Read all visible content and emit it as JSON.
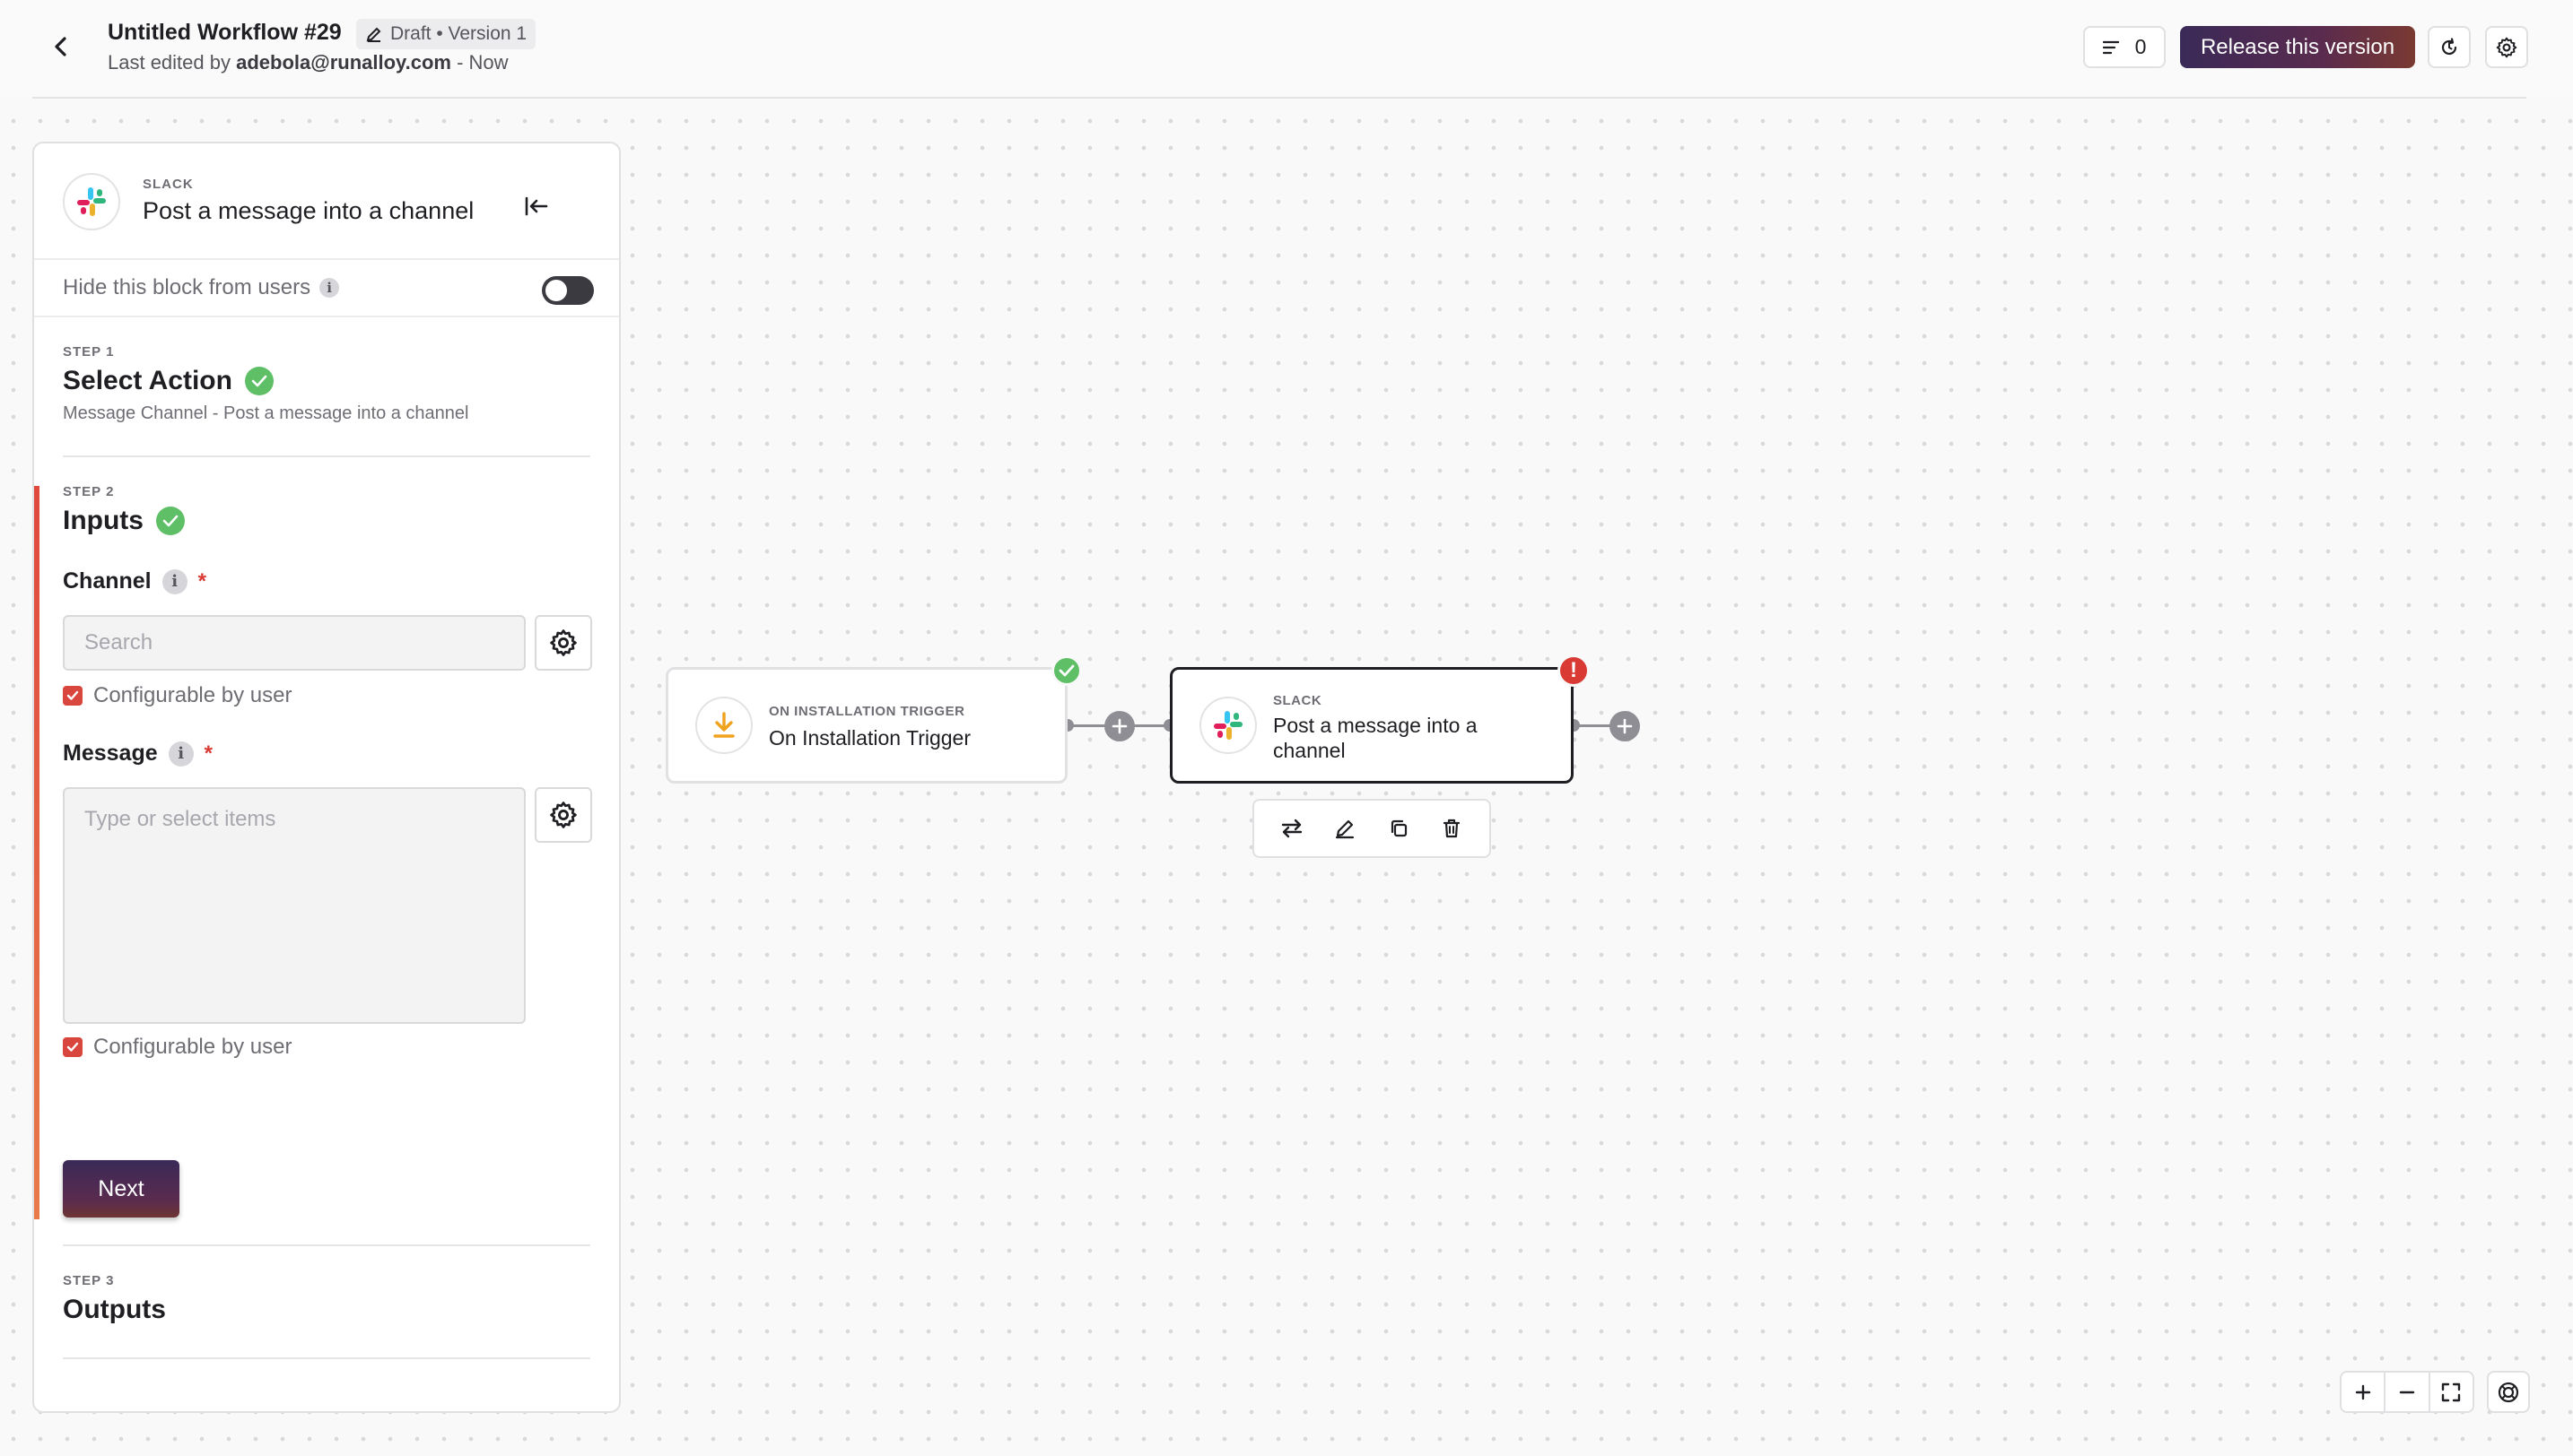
{
  "header": {
    "workflow_title": "Untitled Workflow #29",
    "draft_badge": "Draft • Version 1",
    "last_edited_prefix": "Last edited by",
    "last_edited_user": "adebola@runalloy.com",
    "last_edited_suffix": "- Now",
    "list_count": "0",
    "release_label": "Release this version"
  },
  "panel": {
    "app_name": "SLACK",
    "title": "Post a message into a channel",
    "hide_label": "Hide this block from users",
    "hide_toggle_on": false,
    "step1": {
      "label": "STEP 1",
      "title": "Select Action",
      "subtitle": "Message Channel - Post a message into a channel"
    },
    "step2": {
      "label": "STEP 2",
      "title": "Inputs",
      "channel_label": "Channel",
      "channel_placeholder": "Search",
      "channel_configurable": "Configurable by user",
      "message_label": "Message",
      "message_placeholder": "Type or select items",
      "message_configurable": "Configurable by user",
      "next_label": "Next",
      "required_mark": "*"
    },
    "step3": {
      "label": "STEP 3",
      "title": "Outputs"
    }
  },
  "canvas": {
    "trigger_node": {
      "app": "ON INSTALLATION TRIGGER",
      "name": "On Installation Trigger"
    },
    "slack_node": {
      "app": "SLACK",
      "name_line1": "Post a message into a",
      "name_line2": "channel"
    },
    "error_mark": "!"
  },
  "colors": {
    "accent_dark": "#3a2a58",
    "success": "#5fbf66",
    "error": "#d93a34",
    "checkbox": "#d9463d"
  },
  "icons": {
    "back": "chevron-left-icon",
    "draft": "pencil-icon",
    "list": "list-icon",
    "history": "history-icon",
    "settings": "gear-icon",
    "collapse": "collapse-left-icon",
    "swap": "swap-icon",
    "edit": "pencil-icon",
    "duplicate": "copy-icon",
    "delete": "trash-icon"
  }
}
